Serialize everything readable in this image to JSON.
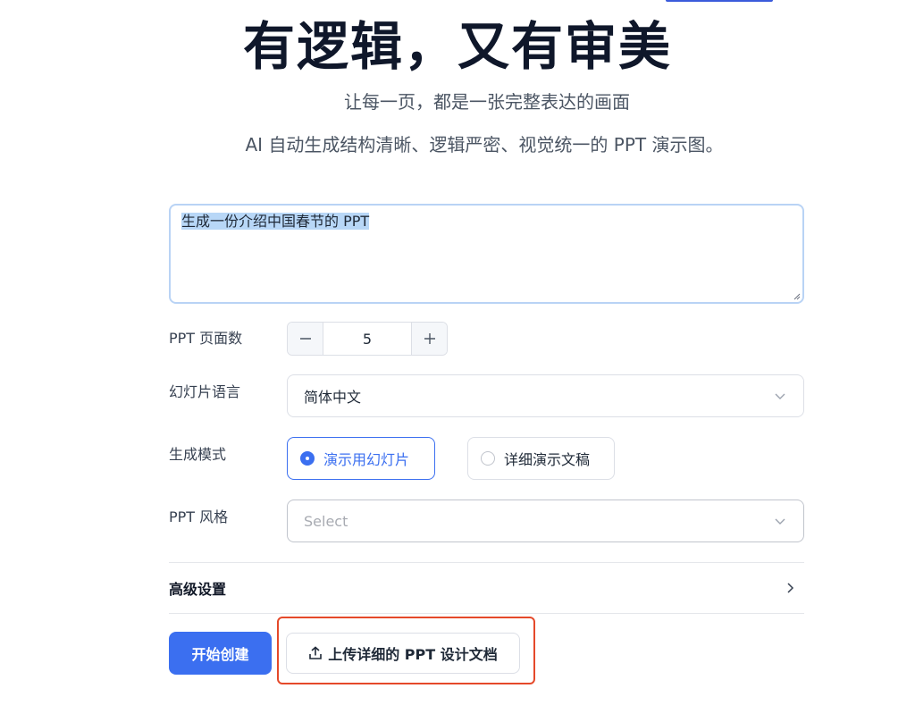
{
  "hero": {
    "title": "有逻辑，又有审美",
    "subtitle": "让每一页，都是一张完整表达的画面",
    "description": "AI 自动生成结构清晰、逻辑严密、视觉统一的 PPT 演示图。"
  },
  "prompt": {
    "value": "生成一份介绍中国春节的 PPT"
  },
  "form": {
    "page_count_label": "PPT 页面数",
    "page_count_value": "5",
    "language_label": "幻灯片语言",
    "language_value": "简体中文",
    "mode_label": "生成模式",
    "mode_options": [
      {
        "label": "演示用幻灯片",
        "selected": true
      },
      {
        "label": "详细演示文稿",
        "selected": false
      }
    ],
    "style_label": "PPT 风格",
    "style_placeholder": "Select"
  },
  "advanced": {
    "label": "高级设置"
  },
  "actions": {
    "start_label": "开始创建",
    "upload_label": "上传详细的 PPT 设计文档"
  },
  "colors": {
    "primary": "#3b6ff0",
    "highlight_frame": "#e5492a",
    "text_selection": "#b8d7f7"
  },
  "icons": {
    "minus": "minus-icon",
    "plus": "plus-icon",
    "chevron_down": "chevron-down-icon",
    "chevron_right": "chevron-right-icon",
    "upload": "upload-icon"
  }
}
